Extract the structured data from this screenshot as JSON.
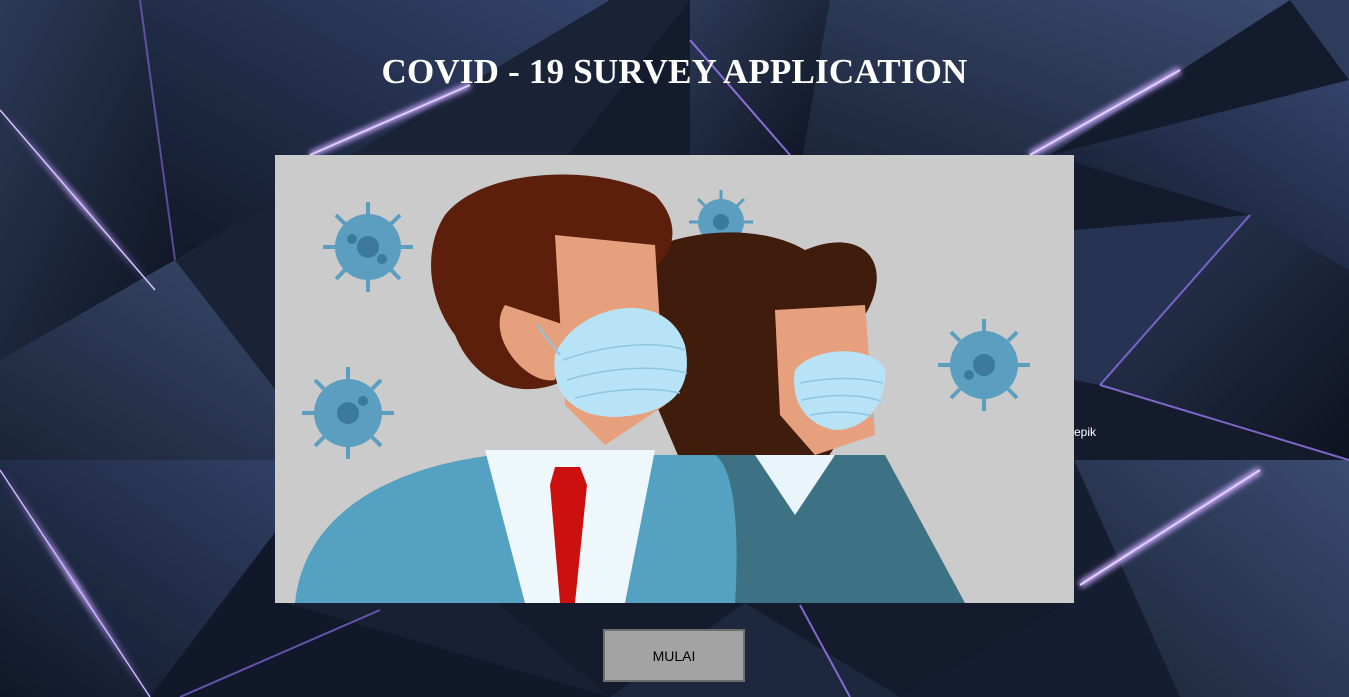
{
  "page": {
    "title": "COVID - 19 SURVEY APPLICATION",
    "stray_text": "epik"
  },
  "hero_image": {
    "description_icon": "masked-people-illustration"
  },
  "actions": {
    "start_label": "MULAI"
  },
  "colors": {
    "background": "#141b2d",
    "accent_glow": "#9b6cff",
    "button_bg": "#a3a3a3",
    "hero_bg": "#cbcbcb"
  }
}
